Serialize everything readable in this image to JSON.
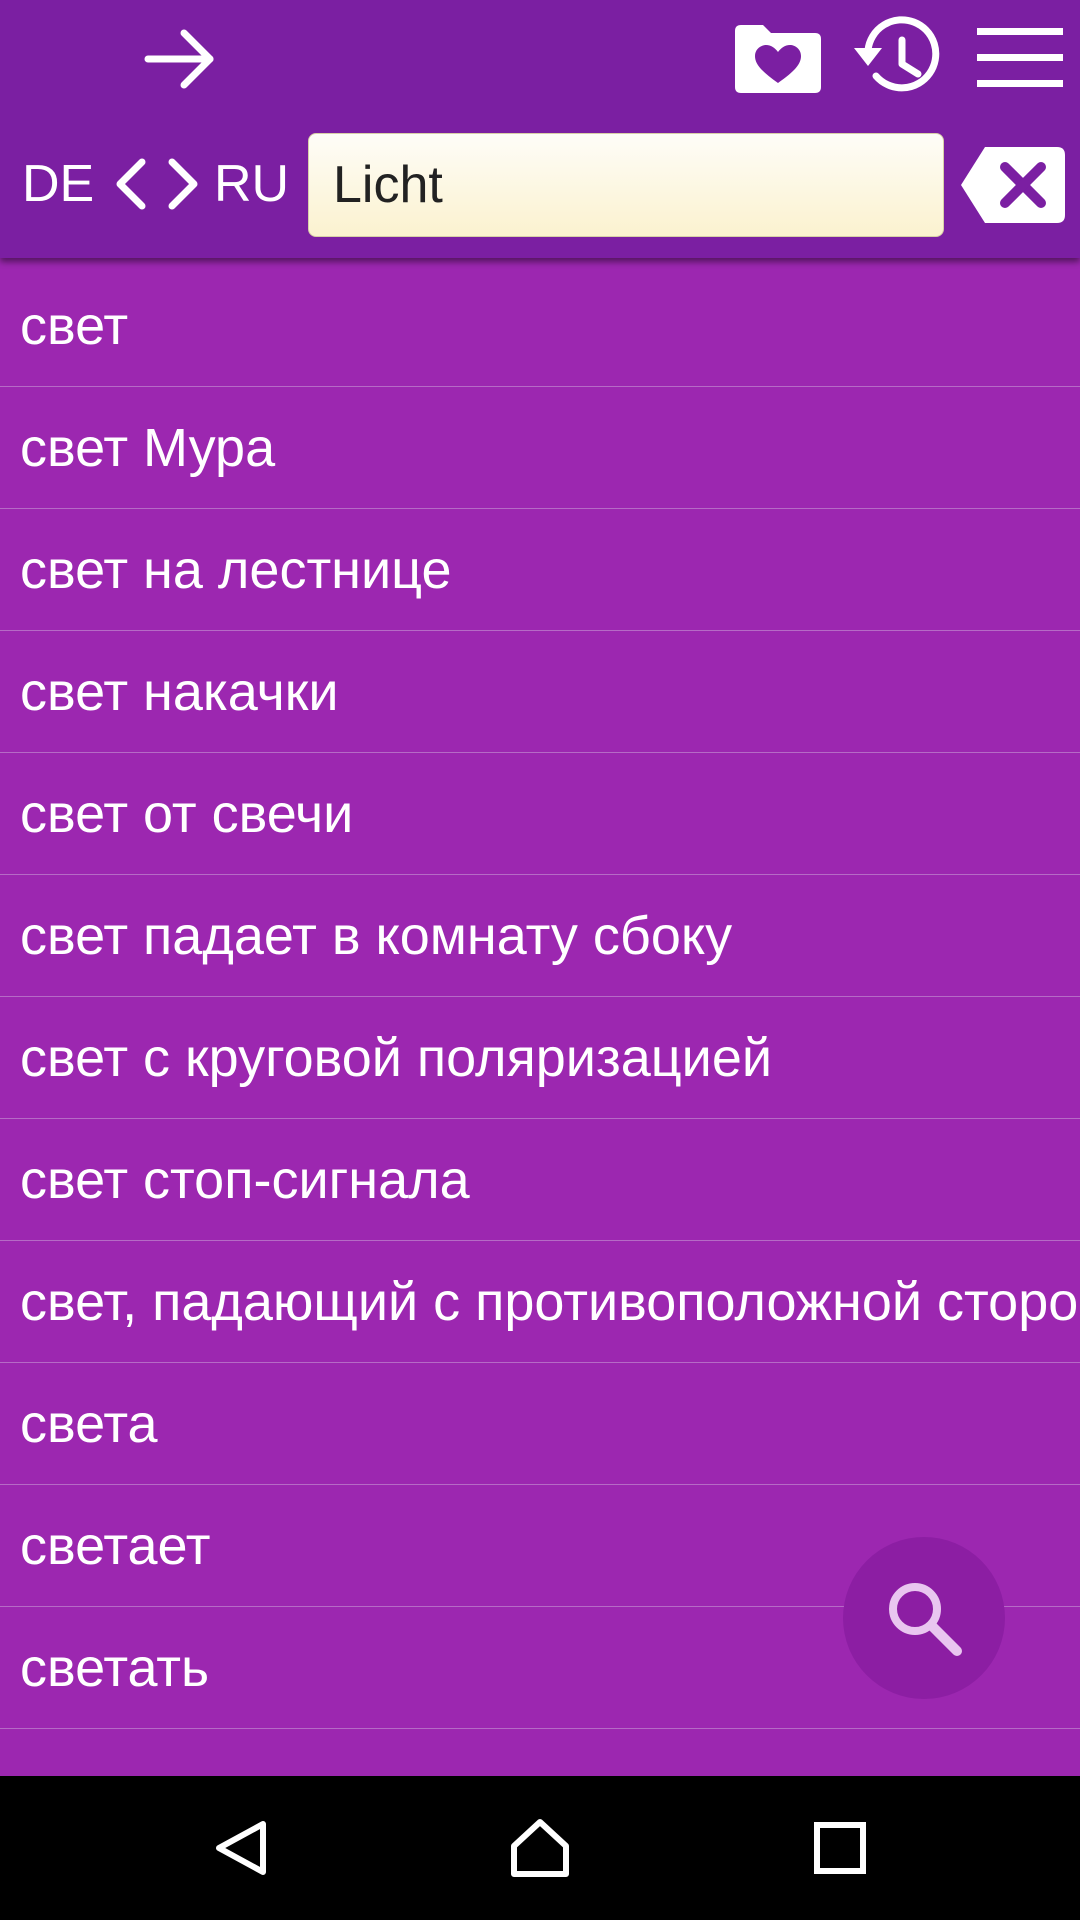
{
  "header": {
    "icons": {
      "forward": "arrow-right-icon",
      "favorites": "folder-heart-icon",
      "history": "history-icon",
      "menu": "hamburger-menu-icon",
      "prev_lang": "chevron-left-icon",
      "next_lang": "chevron-right-icon",
      "clear": "backspace-clear-icon"
    },
    "source_lang": "DE",
    "target_lang": "RU"
  },
  "search": {
    "value": "Licht"
  },
  "results": [
    "свет",
    "свет Мура",
    "свет на лестнице",
    "свет накачки",
    "свет от свечи",
    "свет падает в комнату сбоку",
    "свет с круговой поляризацией",
    "свет стоп-сигнала",
    "свет, падающий с противоположной стороны",
    "света",
    "светает",
    "светать"
  ],
  "fab": {
    "icon": "search-icon"
  },
  "navbar": {
    "icons": [
      "back-triangle-icon",
      "home-icon",
      "recents-square-icon"
    ]
  },
  "colors": {
    "header_bg": "#7b1fa2",
    "list_bg": "#9c27b0",
    "divider": "#b66ac6",
    "fab_bg": "#8c1ea3",
    "search_bg": "#fbf2cf"
  }
}
